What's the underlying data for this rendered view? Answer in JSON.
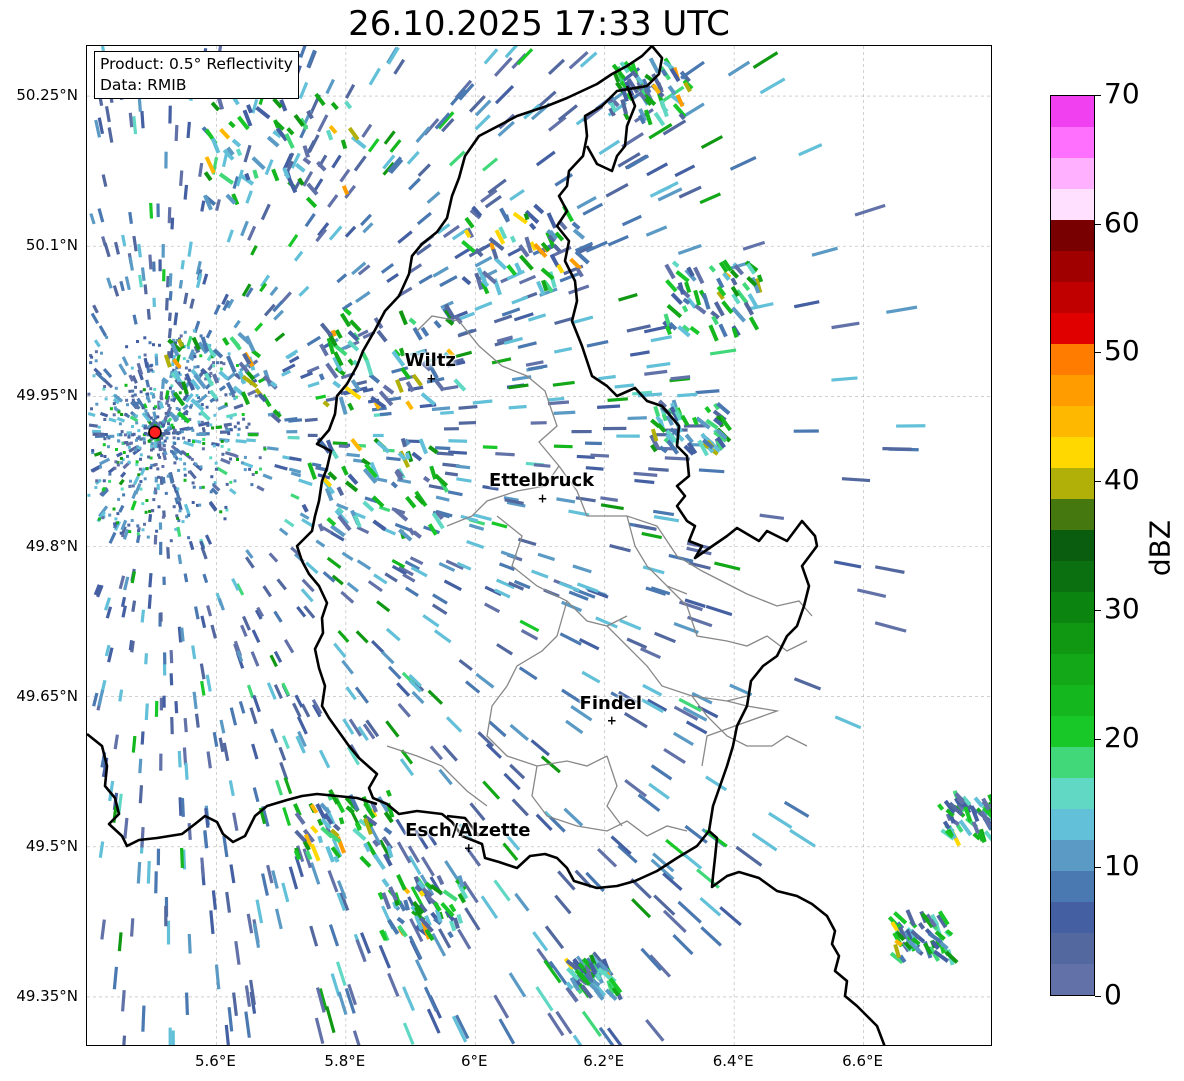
{
  "title": "26.10.2025 17:33 UTC",
  "info_box": {
    "product": "Product: 0.5° Reflectivity",
    "data_source": "Data: RMIB"
  },
  "map": {
    "lon_range": [
      5.4,
      6.8
    ],
    "lat_range": [
      49.3,
      50.3
    ],
    "x_ticks": [
      {
        "lon": 5.6,
        "label": "5.6°E"
      },
      {
        "lon": 5.8,
        "label": "5.8°E"
      },
      {
        "lon": 6.0,
        "label": "6°E"
      },
      {
        "lon": 6.2,
        "label": "6.2°E"
      },
      {
        "lon": 6.4,
        "label": "6.4°E"
      },
      {
        "lon": 6.6,
        "label": "6.6°E"
      }
    ],
    "y_ticks": [
      {
        "lat": 50.25,
        "label": "50.25°N"
      },
      {
        "lat": 50.1,
        "label": "50.1°N"
      },
      {
        "lat": 49.95,
        "label": "49.95°N"
      },
      {
        "lat": 49.8,
        "label": "49.8°N"
      },
      {
        "lat": 49.65,
        "label": "49.65°N"
      },
      {
        "lat": 49.5,
        "label": "49.5°N"
      },
      {
        "lat": 49.35,
        "label": "49.35°N"
      }
    ],
    "radar_site": {
      "lon": 5.505,
      "lat": 49.914
    },
    "cities": [
      {
        "name": "Wiltz",
        "lon": 5.932,
        "lat": 49.968
      },
      {
        "name": "Ettelbruck",
        "lon": 6.104,
        "lat": 49.848
      },
      {
        "name": "Findel",
        "lon": 6.211,
        "lat": 49.626
      },
      {
        "name": "Esch/Alzette",
        "lon": 5.99,
        "lat": 49.499
      }
    ]
  },
  "colorbar": {
    "label": "dBZ",
    "min": 0,
    "max": 70,
    "ticks": [
      "0",
      "10",
      "20",
      "30",
      "40",
      "50",
      "60",
      "70"
    ],
    "colors": [
      "#6272a8",
      "#52689e",
      "#4460a2",
      "#4a78b0",
      "#5a9ac4",
      "#62c0d8",
      "#60d8c4",
      "#40d878",
      "#18c828",
      "#14b81e",
      "#12a818",
      "#109812",
      "#0c8410",
      "#0a7010",
      "#0a5c0e",
      "#467810",
      "#b0b008",
      "#ffd800",
      "#ffb800",
      "#ff9c00",
      "#ff7c00",
      "#e00000",
      "#c00000",
      "#a00000",
      "#780000",
      "#ffe0ff",
      "#ffb0ff",
      "#ff70ff",
      "#f040f0"
    ]
  }
}
